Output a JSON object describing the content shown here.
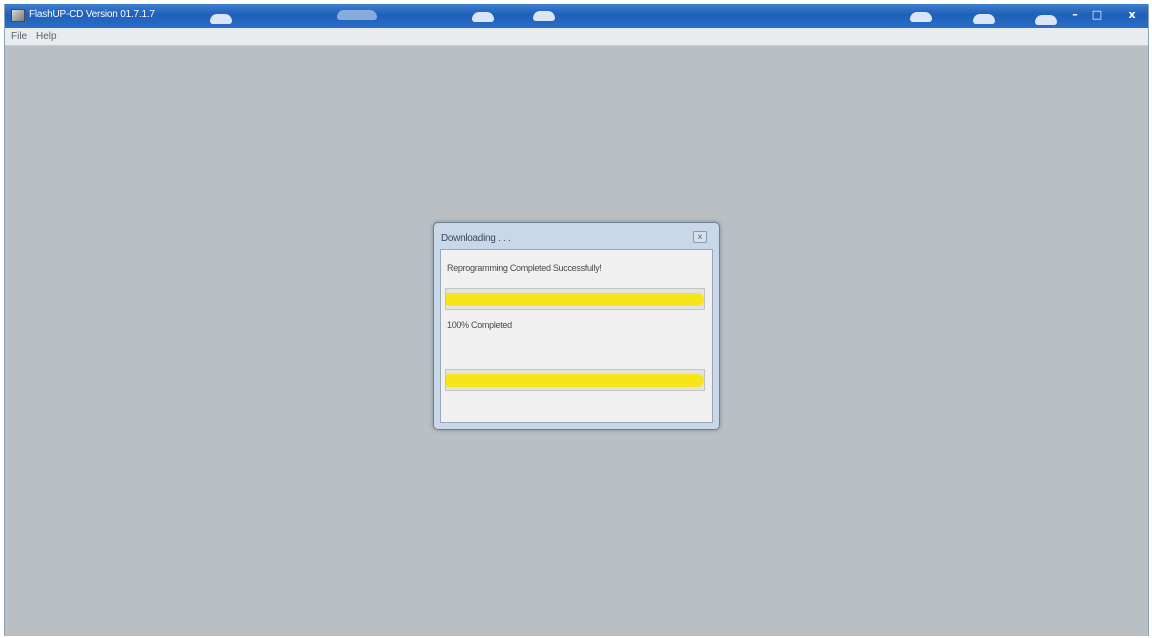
{
  "window": {
    "title": "FlashUP-CD Version 01.7.1.7",
    "minimize_glyph": "–",
    "maximize_glyph": "□",
    "close_glyph": "x"
  },
  "menu": {
    "items": [
      "File",
      "Help"
    ]
  },
  "dialog": {
    "title": "Downloading . . .",
    "close_glyph": "x",
    "status_message": "Reprogramming Completed Successfully!",
    "percent_text": "100% Completed",
    "progress_overall": 1.0,
    "progress_current": 1.0
  },
  "colors": {
    "titlebar": "#2a6ec9",
    "workspace": "#b9bfc2",
    "progress_fill": "#f5e51a"
  },
  "icons": {
    "app_icon": "flashup-app-icon",
    "close_icon": "close-icon"
  }
}
